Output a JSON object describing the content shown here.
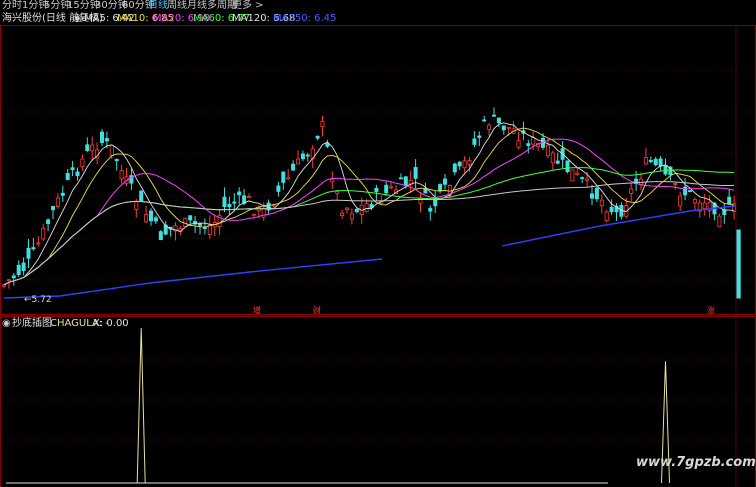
{
  "toolbar": {
    "items": [
      {
        "label": "分时",
        "active": false
      },
      {
        "label": "1分钟",
        "active": false
      },
      {
        "label": "5分钟",
        "active": false
      },
      {
        "label": "15分钟",
        "active": false
      },
      {
        "label": "30分钟",
        "active": false
      },
      {
        "label": "60分钟",
        "active": false
      },
      {
        "label": "日线",
        "active": true
      },
      {
        "label": "周线",
        "active": false
      },
      {
        "label": "月线",
        "active": false
      },
      {
        "label": "多周期",
        "active": false
      },
      {
        "label": "更多 >",
        "active": false
      }
    ]
  },
  "main_panel": {
    "stock_title": "海兴股份(日线 前复权)",
    "ma_items": [
      {
        "label": "MA5: 6.42",
        "color": "#e0e0e0"
      },
      {
        "label": "MA10: 6.85",
        "color": "#f0e040"
      },
      {
        "label": "MA20: 6.98",
        "color": "#ff40ff"
      },
      {
        "label": "MA60: 6.77",
        "color": "#40ff40"
      },
      {
        "label": "MA120: 6.68",
        "color": "#e0e0e0"
      },
      {
        "label": "MA250: 6.45",
        "color": "#4060ff"
      }
    ],
    "low_price_label": "←5.72",
    "markers": [
      {
        "text": "增"
      },
      {
        "text": "财"
      },
      {
        "text": "涨"
      }
    ]
  },
  "sub_panel": {
    "title": "抄底插图",
    "indicator": "CHAGULA: -",
    "value": "X: 0.00"
  },
  "watermark": "www.7gpzb.com",
  "colors": {
    "up": "#ff3a3a",
    "down": "#40e0e0",
    "ma5": "#e0e0e0",
    "ma10": "#f0e040",
    "ma20": "#ff40ff",
    "ma60": "#40ff40",
    "ma120": "#c8c8c8",
    "ma250": "#3040ff",
    "grid": "#8a0000",
    "indicator": "#e8e0a0"
  },
  "indicator_spikes": [
    {
      "bar_index": 28,
      "value": 1.0
    },
    {
      "bar_index": 135,
      "value": 0.78
    }
  ]
}
